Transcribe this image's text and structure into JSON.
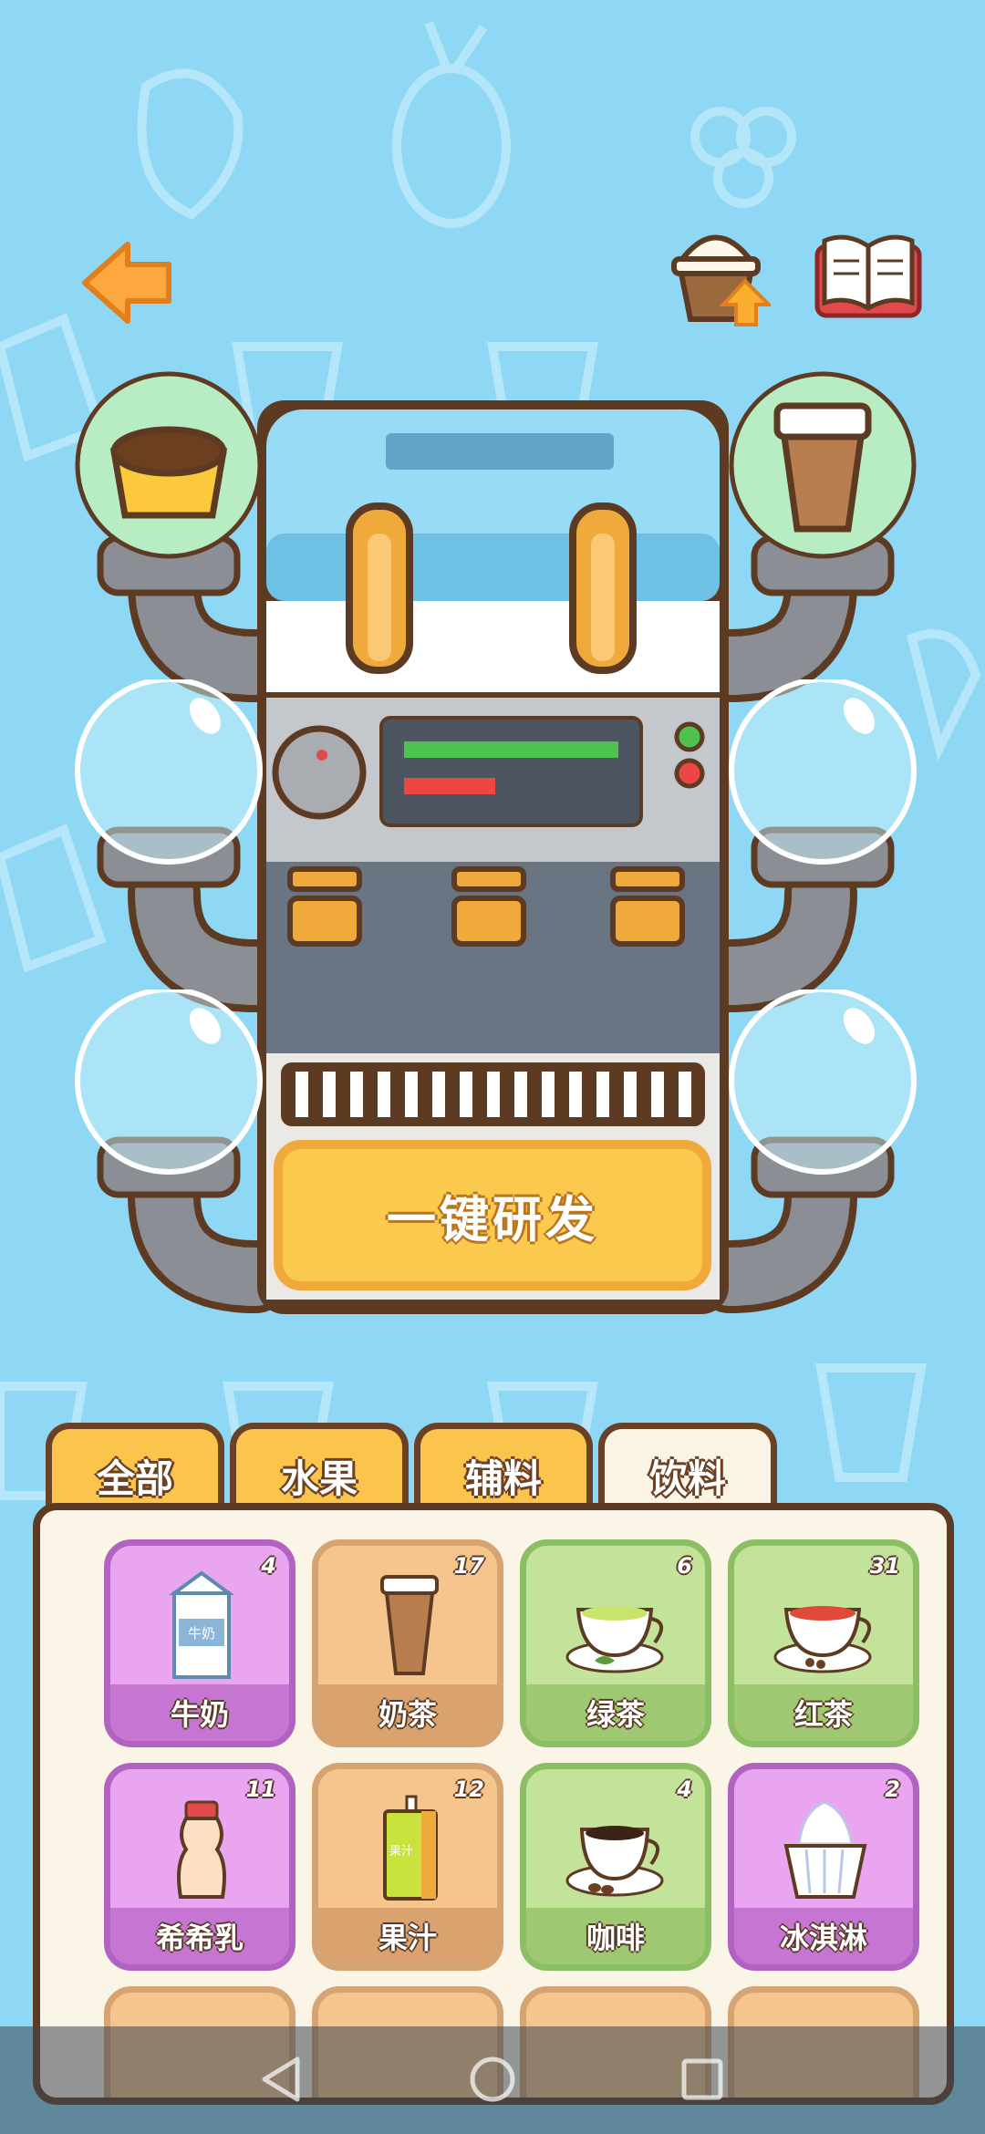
{
  "colors": {
    "background": "#8fd8f5",
    "tab": "#fbc44c",
    "tab_active": "#fbf3e3",
    "outline": "#5d3a22"
  },
  "header": {
    "back_icon": "left-arrow-icon",
    "upgrade_icon": "cup-upgrade-icon",
    "recipe_icon": "open-book-icon"
  },
  "machine": {
    "oneclick_label": "一键研发",
    "slots": [
      {
        "position": "top-left",
        "item_icon": "pudding-icon"
      },
      {
        "position": "top-right",
        "item_icon": "milk-tea-cup-icon"
      },
      {
        "position": "middle-left",
        "item_icon": ""
      },
      {
        "position": "middle-right",
        "item_icon": ""
      },
      {
        "position": "bottom-left",
        "item_icon": ""
      },
      {
        "position": "bottom-right",
        "item_icon": ""
      }
    ]
  },
  "tabs": [
    {
      "label": "全部",
      "active": false
    },
    {
      "label": "水果",
      "active": false
    },
    {
      "label": "辅料",
      "active": false
    },
    {
      "label": "饮料",
      "active": true
    }
  ],
  "items": [
    {
      "name": "牛奶",
      "count": "4",
      "color": "purple",
      "icon": "milk-carton-icon"
    },
    {
      "name": "奶茶",
      "count": "17",
      "color": "orange",
      "icon": "milk-tea-cup-icon"
    },
    {
      "name": "绿茶",
      "count": "6",
      "color": "green",
      "icon": "green-tea-icon"
    },
    {
      "name": "红茶",
      "count": "31",
      "color": "green",
      "icon": "black-tea-icon"
    },
    {
      "name": "希希乳",
      "count": "11",
      "color": "purple",
      "icon": "yogurt-bottle-icon"
    },
    {
      "name": "果汁",
      "count": "12",
      "color": "orange",
      "icon": "juice-box-icon"
    },
    {
      "name": "咖啡",
      "count": "4",
      "color": "green",
      "icon": "coffee-cup-icon"
    },
    {
      "name": "冰淇淋",
      "count": "2",
      "color": "purple",
      "icon": "ice-cream-icon"
    }
  ],
  "milk_carton_text": "牛奶",
  "juice_box_text": "果汁",
  "navbar": {
    "back_icon": "nav-back-icon",
    "home_icon": "nav-home-icon",
    "recents_icon": "nav-recents-icon"
  }
}
